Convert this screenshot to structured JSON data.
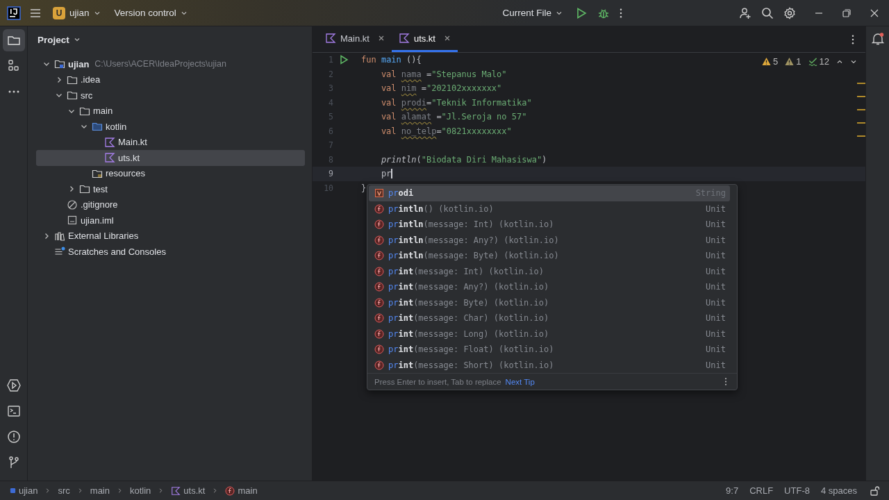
{
  "title_bar": {
    "project": {
      "badge": "U",
      "name": "ujian"
    },
    "vcs": "Version control",
    "run_config": "Current File"
  },
  "project_panel": {
    "title": "Project",
    "tree": [
      {
        "label": "ujian",
        "kind": "module",
        "hint": "C:\\Users\\ACER\\IdeaProjects\\ujian",
        "expanded": true,
        "selected": false,
        "children": [
          {
            "label": ".idea",
            "kind": "folder",
            "expanded": false,
            "selected": false
          },
          {
            "label": "src",
            "kind": "folder",
            "expanded": true,
            "selected": false,
            "children": [
              {
                "label": "main",
                "kind": "folder",
                "expanded": true,
                "selected": false,
                "children": [
                  {
                    "label": "kotlin",
                    "kind": "source-folder",
                    "expanded": true,
                    "selected": false,
                    "children": [
                      {
                        "label": "Main.kt",
                        "kind": "kotlin-file",
                        "selected": false
                      },
                      {
                        "label": "uts.kt",
                        "kind": "kotlin-file",
                        "selected": true
                      }
                    ]
                  },
                  {
                    "label": "resources",
                    "kind": "resources",
                    "selected": false
                  }
                ]
              },
              {
                "label": "test",
                "kind": "folder",
                "expanded": false,
                "selected": false
              }
            ]
          },
          {
            "label": ".gitignore",
            "kind": "ignore",
            "selected": false
          },
          {
            "label": "ujian.iml",
            "kind": "iml",
            "selected": false
          }
        ]
      },
      {
        "label": "External Libraries",
        "kind": "libraries",
        "expanded": false,
        "selected": false
      },
      {
        "label": "Scratches and Consoles",
        "kind": "scratches",
        "selected": false
      }
    ]
  },
  "tabs": [
    {
      "label": "Main.kt",
      "selected": false
    },
    {
      "label": "uts.kt",
      "selected": true
    }
  ],
  "inspections": [
    {
      "kind": "warning",
      "count": "5"
    },
    {
      "kind": "weak",
      "count": "1"
    },
    {
      "kind": "typo",
      "count": "12"
    }
  ],
  "code": [
    {
      "number": "1",
      "run_marker": true,
      "current": false,
      "tokens": [
        {
          "kind": "kw",
          "text": "fun "
        },
        {
          "kind": "fn",
          "text": "main"
        },
        {
          "kind": "plain",
          "text": " (){"
        }
      ]
    },
    {
      "number": "2",
      "run_marker": false,
      "current": false,
      "tokens": [
        {
          "kind": "kw",
          "text": "    val "
        },
        {
          "kind": "unused",
          "text": "nama"
        },
        {
          "kind": "plain",
          "text": " ="
        },
        {
          "kind": "string",
          "text": "\"Stepanus Malo\""
        }
      ]
    },
    {
      "number": "3",
      "run_marker": false,
      "current": false,
      "tokens": [
        {
          "kind": "kw",
          "text": "    val "
        },
        {
          "kind": "unused",
          "text": "nim"
        },
        {
          "kind": "plain",
          "text": " ="
        },
        {
          "kind": "string",
          "text": "\"202102xxxxxxx\""
        }
      ]
    },
    {
      "number": "4",
      "run_marker": false,
      "current": false,
      "tokens": [
        {
          "kind": "kw",
          "text": "    val "
        },
        {
          "kind": "unused",
          "text": "prodi"
        },
        {
          "kind": "plain",
          "text": "="
        },
        {
          "kind": "string",
          "text": "\"Teknik Informatika\""
        }
      ]
    },
    {
      "number": "5",
      "run_marker": false,
      "current": false,
      "tokens": [
        {
          "kind": "kw",
          "text": "    val "
        },
        {
          "kind": "unused",
          "text": "alamat"
        },
        {
          "kind": "plain",
          "text": " ="
        },
        {
          "kind": "string",
          "text": "\"Jl.Seroja no 57\""
        }
      ]
    },
    {
      "number": "6",
      "run_marker": false,
      "current": false,
      "tokens": [
        {
          "kind": "kw",
          "text": "    val "
        },
        {
          "kind": "unused",
          "text": "no_telp"
        },
        {
          "kind": "plain",
          "text": "="
        },
        {
          "kind": "string",
          "text": "\"0821xxxxxxxx\""
        }
      ]
    },
    {
      "number": "7",
      "run_marker": false,
      "current": false
    },
    {
      "number": "8",
      "run_marker": false,
      "current": false,
      "tokens": [
        {
          "kind": "call",
          "text": "    println"
        },
        {
          "kind": "plain",
          "text": "("
        },
        {
          "kind": "string",
          "text": "\"Biodata Diri Mahasiswa\""
        },
        {
          "kind": "plain",
          "text": ")"
        }
      ]
    },
    {
      "number": "9",
      "run_marker": false,
      "current": true,
      "tokens": [
        {
          "kind": "plain",
          "text": "    pr"
        }
      ]
    },
    {
      "number": "10",
      "run_marker": false,
      "current": false,
      "tokens": [
        {
          "kind": "plain",
          "text": "}"
        }
      ]
    }
  ],
  "completion": {
    "items": [
      {
        "kind": "variable",
        "match": "pr",
        "rest": "odi",
        "type": "String",
        "selected": true
      },
      {
        "kind": "function",
        "match": "pr",
        "rest": "intln",
        "detail": "() (kotlin.io)",
        "type": "Unit",
        "selected": false
      },
      {
        "kind": "function",
        "match": "pr",
        "rest": "intln",
        "detail": "(message: Int) (kotlin.io)",
        "type": "Unit",
        "selected": false
      },
      {
        "kind": "function",
        "match": "pr",
        "rest": "intln",
        "detail": "(message: Any?) (kotlin.io)",
        "type": "Unit",
        "selected": false
      },
      {
        "kind": "function",
        "match": "pr",
        "rest": "intln",
        "detail": "(message: Byte) (kotlin.io)",
        "type": "Unit",
        "selected": false
      },
      {
        "kind": "function",
        "match": "pr",
        "rest": "int",
        "detail": "(message: Int) (kotlin.io)",
        "type": "Unit",
        "selected": false
      },
      {
        "kind": "function",
        "match": "pr",
        "rest": "int",
        "detail": "(message: Any?) (kotlin.io)",
        "type": "Unit",
        "selected": false
      },
      {
        "kind": "function",
        "match": "pr",
        "rest": "int",
        "detail": "(message: Byte) (kotlin.io)",
        "type": "Unit",
        "selected": false
      },
      {
        "kind": "function",
        "match": "pr",
        "rest": "int",
        "detail": "(message: Char) (kotlin.io)",
        "type": "Unit",
        "selected": false
      },
      {
        "kind": "function",
        "match": "pr",
        "rest": "int",
        "detail": "(message: Long) (kotlin.io)",
        "type": "Unit",
        "selected": false
      },
      {
        "kind": "function",
        "match": "pr",
        "rest": "int",
        "detail": "(message: Float) (kotlin.io)",
        "type": "Unit",
        "selected": false
      },
      {
        "kind": "function",
        "match": "pr",
        "rest": "int",
        "detail": "(message: Short) (kotlin.io)",
        "type": "Unit",
        "selected": false
      }
    ],
    "hint": "Press Enter to insert, Tab to replace",
    "link": "Next Tip"
  },
  "status_bar": {
    "breadcrumbs": [
      {
        "kind": "module",
        "label": "ujian"
      },
      {
        "kind": "folder",
        "label": "src"
      },
      {
        "kind": "folder",
        "label": "main"
      },
      {
        "kind": "folder",
        "label": "kotlin"
      },
      {
        "kind": "kotlin-file",
        "label": "uts.kt"
      },
      {
        "kind": "function",
        "label": "main"
      }
    ],
    "widgets": [
      "9:7",
      "CRLF",
      "UTF-8",
      "4 spaces"
    ]
  }
}
